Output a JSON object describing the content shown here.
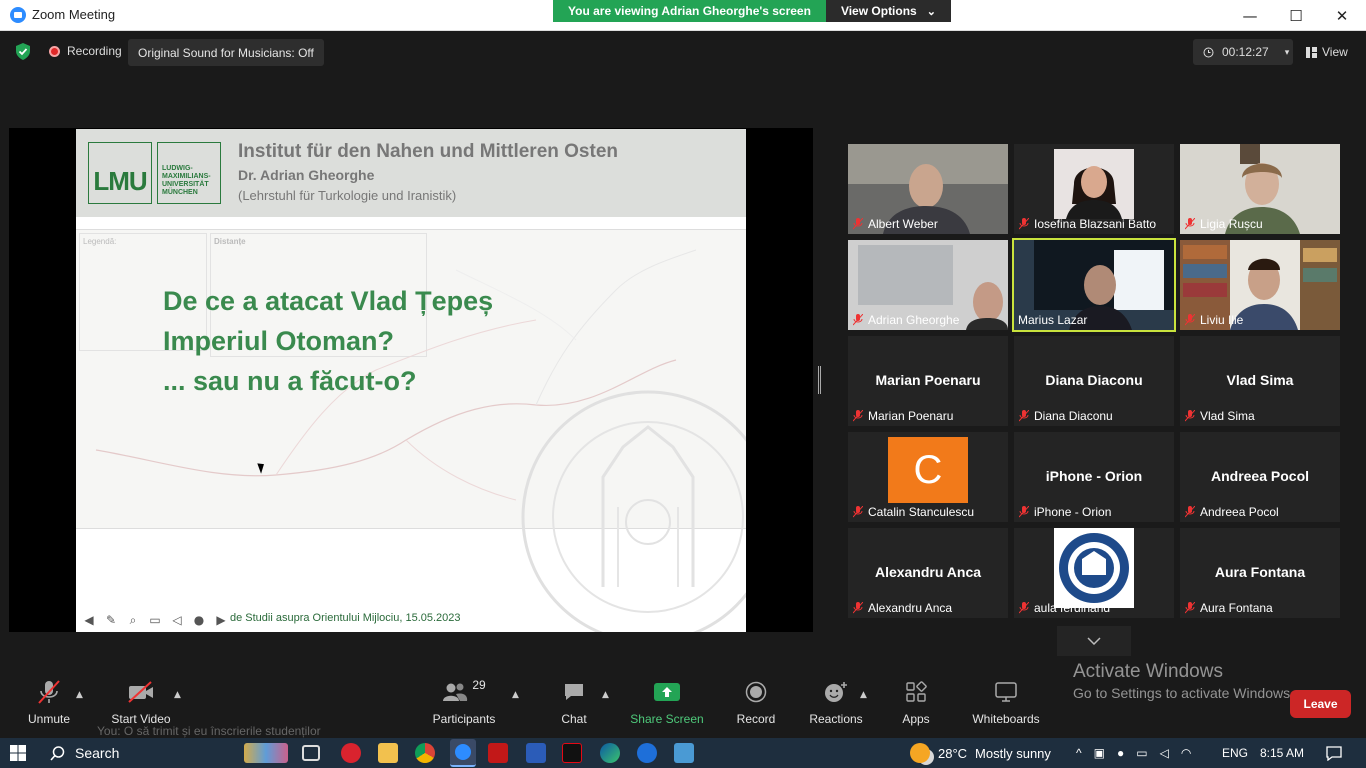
{
  "window": {
    "title": "Zoom Meeting",
    "minimize": "—",
    "maximize": "☐",
    "close": "✕"
  },
  "banner": {
    "message": "You are viewing Adrian Gheorghe's screen",
    "options": "View Options",
    "chevron": "⌄"
  },
  "topbar": {
    "recording": "Recording",
    "original_sound": "Original Sound for Musicians: Off",
    "timer": "00:12:27",
    "timer_caret": "▾",
    "view": "View"
  },
  "slide": {
    "institute": "Institut für den Nahen und Mittleren Osten",
    "presenter": "Dr. Adrian Gheorghe",
    "chair": "(Lehrstuhl für Turkologie und Iranistik)",
    "logo_text": "LMU",
    "logo_lines": [
      "LUDWIG-",
      "MAXIMILIANS-",
      "UNIVERSITÄT",
      "MÜNCHEN"
    ],
    "title_lines": [
      "De ce a atacat Vlad Țepeș",
      "Imperiul Otoman?",
      "... sau nu a făcut-o?"
    ],
    "footer": "de Studii asupra Orientului Mijlociu, 15.05.2023",
    "legend_label": "Legendă:",
    "distances_label": "Distanțe"
  },
  "participants": [
    {
      "name": "Albert Weber",
      "type": "video"
    },
    {
      "name": "Iosefina Blazsani Batto",
      "type": "video"
    },
    {
      "name": "Ligia Rușcu",
      "type": "video"
    },
    {
      "name": "Adrian Gheorghe",
      "type": "video"
    },
    {
      "name": "Marius Lazar",
      "type": "video",
      "active": true
    },
    {
      "name": "Liviu Ilie",
      "type": "video"
    },
    {
      "name": "Marian Poenaru",
      "type": "name"
    },
    {
      "name": "Diana Diaconu",
      "type": "name"
    },
    {
      "name": "Vlad Sima",
      "type": "name"
    },
    {
      "name": "Catalin Stanculescu",
      "type": "avatar",
      "initial": "C"
    },
    {
      "name": "iPhone - Orion",
      "type": "name"
    },
    {
      "name": "Andreea Pocol",
      "type": "name"
    },
    {
      "name": "Alexandru Anca",
      "type": "name"
    },
    {
      "name": "aula ferdinand",
      "type": "logo"
    },
    {
      "name": "Aura Fontana",
      "type": "name"
    }
  ],
  "activation": {
    "title": "Activate Windows",
    "subtitle": "Go to Settings to activate Windows."
  },
  "toolbar": {
    "unmute": "Unmute",
    "start_video": "Start Video",
    "participants": "Participants",
    "participant_count": "29",
    "chat": "Chat",
    "share_screen": "Share Screen",
    "record": "Record",
    "reactions": "Reactions",
    "apps": "Apps",
    "whiteboards": "Whiteboards",
    "leave": "Leave",
    "chat_preview": "You: O să trimit și eu înscrierile studenților"
  },
  "taskbar": {
    "search": "Search",
    "temperature": "28°C",
    "weather": "Mostly sunny",
    "language": "ENG",
    "time": "8:15 AM"
  },
  "colors": {
    "accent_green": "#23a455",
    "leave_red": "#cc2626",
    "active_speaker": "#c9e33d",
    "slide_green": "#3a8a4e"
  }
}
